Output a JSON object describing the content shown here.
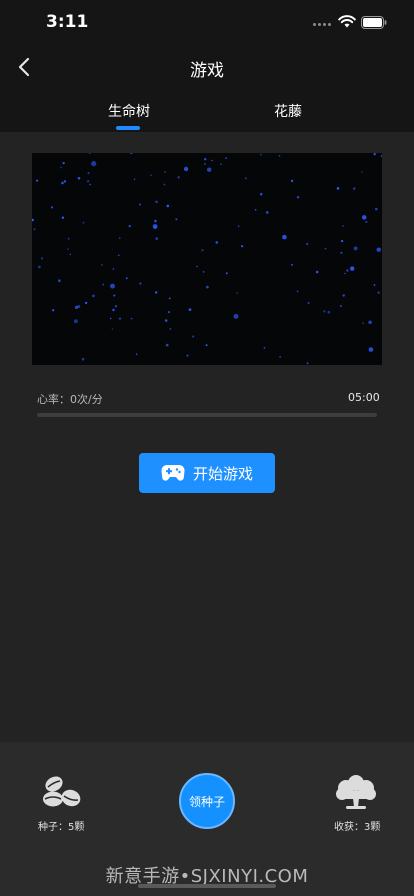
{
  "status_bar": {
    "time": "3:11"
  },
  "nav": {
    "title": "游戏"
  },
  "tabs": [
    {
      "label": "生命树",
      "active": true
    },
    {
      "label": "花藤",
      "active": false
    }
  ],
  "game": {
    "heart_rate_label": "心率：0次/分",
    "timer": "05:00",
    "progress": 0,
    "start_button_label": "开始游戏"
  },
  "bottom": {
    "seeds_label": "种子：5颗",
    "get_seed_label": "领种子",
    "harvest_label": "收获：3颗",
    "watermark": "新意手游•SJXINYI.COM"
  },
  "colors": {
    "accent": "#1e90ff",
    "background": "#232323",
    "header": "#151515",
    "bottom_panel": "#2b2b2b",
    "particle": "#2f5bff"
  },
  "icons": [
    "wifi-icon",
    "battery-icon",
    "back-chevron-icon",
    "gamepad-icon",
    "seeds-icon",
    "tree-icon"
  ]
}
